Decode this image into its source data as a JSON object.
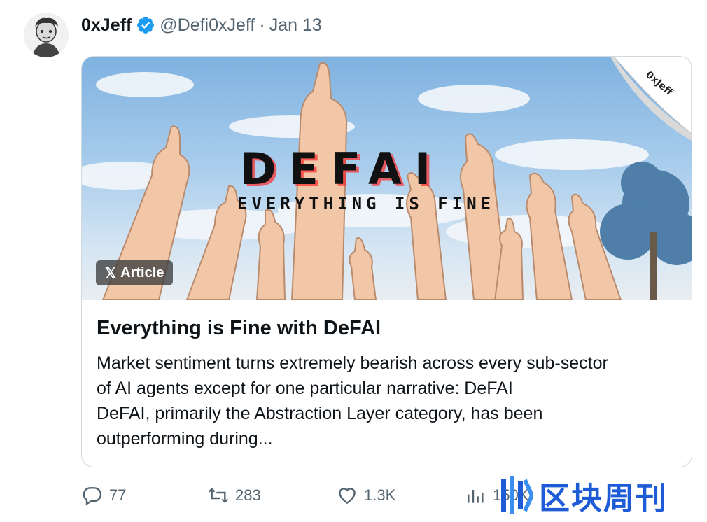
{
  "tweet": {
    "author_name": "0xJeff",
    "handle": "@Defi0xJeff",
    "separator": "·",
    "date": "Jan 13"
  },
  "card": {
    "hero_title": "DEFAI",
    "hero_subtitle": "EVERYTHING IS FINE",
    "corner_sticker": "0xJeff",
    "badge_x": "𝕏",
    "badge_label": "Article",
    "title": "Everything is Fine with DeFAI",
    "description_lines": [
      "Market sentiment turns extremely bearish across every sub-sector",
      "of AI agents except for one particular narrative: DeFAI",
      "DeFAI, primarily the Abstraction Layer category, has been",
      "outperforming during..."
    ]
  },
  "actions": {
    "replies": "77",
    "reposts": "283",
    "likes": "1.3K",
    "views": "150K"
  },
  "watermark": {
    "text": "区块周刊"
  },
  "colors": {
    "verified": "#1d9bf0",
    "muted": "#536471",
    "text": "#0f1419",
    "watermark": "#1e5bd6"
  },
  "icons": [
    "verified-badge-icon",
    "x-logo-icon",
    "reply-icon",
    "repost-icon",
    "like-icon",
    "views-icon"
  ]
}
